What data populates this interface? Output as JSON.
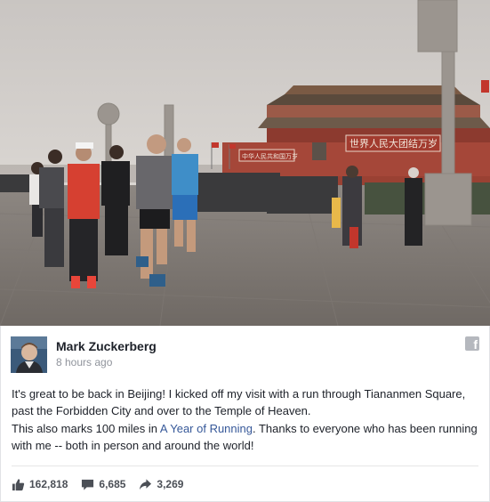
{
  "post": {
    "author": "Mark Zuckerberg",
    "timestamp": "8 hours ago",
    "paragraph1": "It's great to be back in Beijing! I kicked off my visit with a run through Tiananmen Square, past the Forbidden City and over to the Temple of Heaven.",
    "paragraph2_before": "This also marks 100 miles in ",
    "paragraph2_link": "A Year of Running",
    "paragraph2_after": ". Thanks to everyone who has been running with me -- both in person and around the world!",
    "network_icon": "f"
  },
  "stats": {
    "likes": "162,818",
    "comments": "6,685",
    "shares": "3,269"
  },
  "photo": {
    "banner_left": "中华人民共和国万岁",
    "banner_right": "世界人民大团结万岁"
  },
  "colors": {
    "link": "#365899",
    "text": "#1d2129",
    "muted": "#90949c",
    "stat_text": "#4b4f56"
  },
  "icons": {
    "like": "thumbs-up-icon",
    "comment": "speech-bubble-icon",
    "share": "share-arrow-icon",
    "network": "facebook-icon"
  }
}
